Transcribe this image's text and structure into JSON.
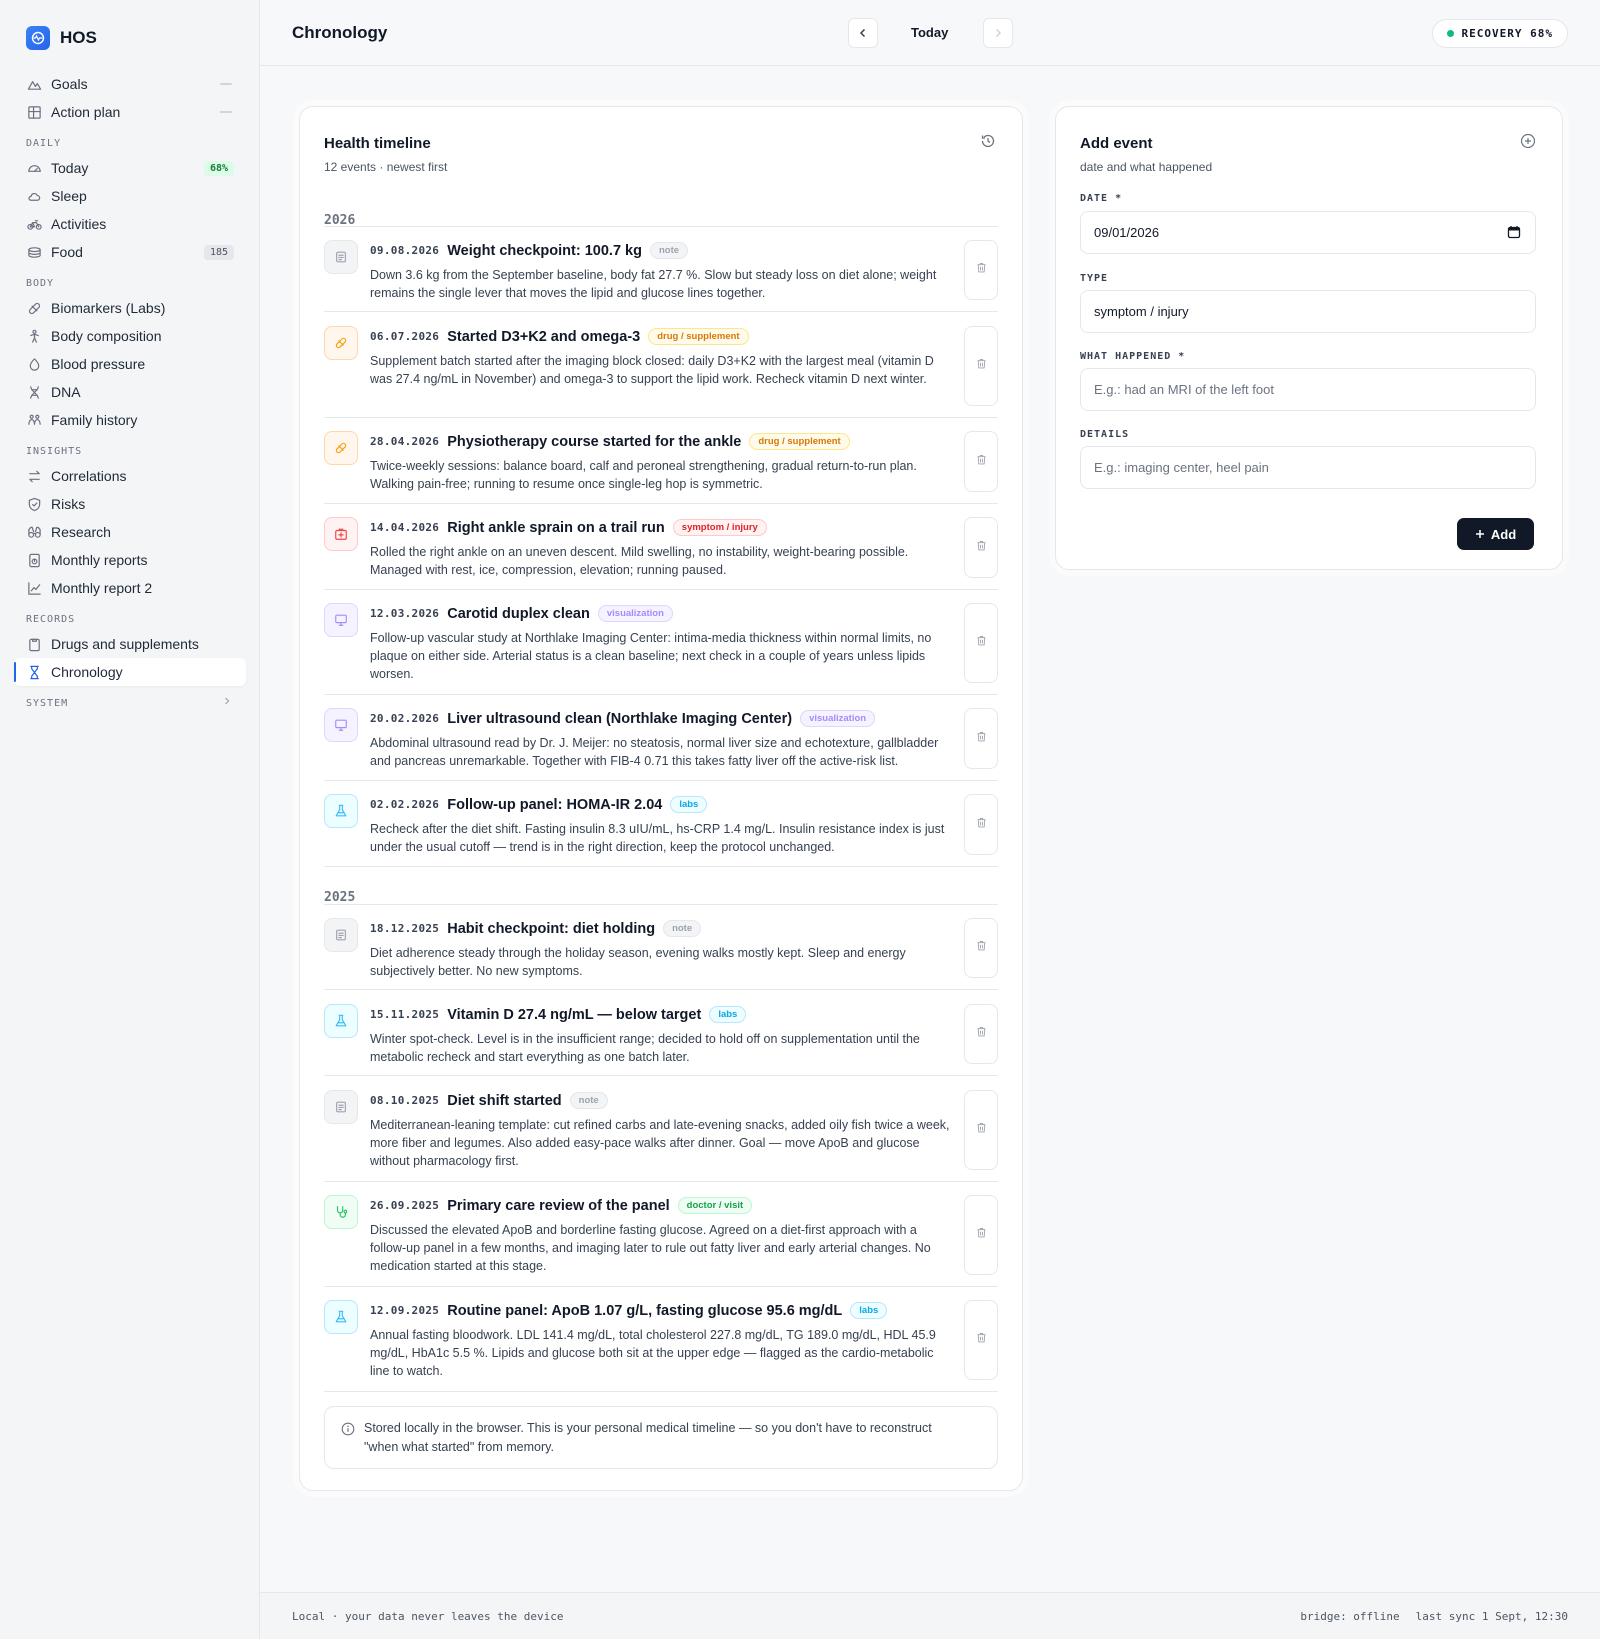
{
  "app": {
    "name": "HOS"
  },
  "sidebar": {
    "top_items": [
      {
        "label": "Goals",
        "icon": "mountain-icon"
      },
      {
        "label": "Action plan",
        "icon": "grid-icon"
      }
    ],
    "groups": [
      {
        "label": "DAILY",
        "items": [
          {
            "label": "Today",
            "icon": "gauge-icon",
            "badge": "68%"
          },
          {
            "label": "Sleep",
            "icon": "moon-cloud-icon"
          },
          {
            "label": "Activities",
            "icon": "bike-icon"
          },
          {
            "label": "Food",
            "icon": "bowl-icon",
            "badge": "185"
          }
        ]
      },
      {
        "label": "BODY",
        "items": [
          {
            "label": "Biomarkers (Labs)",
            "icon": "pill-icon"
          },
          {
            "label": "Body composition",
            "icon": "person-icon"
          },
          {
            "label": "Blood pressure",
            "icon": "drop-icon"
          },
          {
            "label": "DNA",
            "icon": "dna-icon"
          },
          {
            "label": "Family history",
            "icon": "family-icon"
          }
        ]
      },
      {
        "label": "INSIGHTS",
        "items": [
          {
            "label": "Correlations",
            "icon": "arrows-icon"
          },
          {
            "label": "Risks",
            "icon": "shield-icon"
          },
          {
            "label": "Research",
            "icon": "binoculars-icon"
          },
          {
            "label": "Monthly reports",
            "icon": "report-icon"
          },
          {
            "label": "Monthly report 2",
            "icon": "chart-line-icon"
          }
        ]
      },
      {
        "label": "RECORDS",
        "items": [
          {
            "label": "Drugs and supplements",
            "icon": "clipboard-icon"
          },
          {
            "label": "Chronology",
            "icon": "hourglass-icon",
            "active": true
          }
        ]
      }
    ],
    "system_label": "SYSTEM"
  },
  "header": {
    "title": "Chronology",
    "today_label": "Today",
    "recovery": "RECOVERY 68%",
    "recovery_color": "#10b981"
  },
  "timeline": {
    "title": "Health timeline",
    "subtitle": "12 events · newest first",
    "years": [
      {
        "year": "2026",
        "events": [
          {
            "date": "09.08.2026",
            "title": "Weight checkpoint: 100.7 kg",
            "tag": "note",
            "kind": "note",
            "desc": "Down 3.6 kg from the September baseline, body fat 27.7 %. Slow but steady loss on diet alone; weight remains the single lever that moves the lipid and glucose lines together."
          },
          {
            "date": "06.07.2026",
            "title": "Started D3+K2 and omega-3",
            "tag": "drug / supplement",
            "kind": "drug",
            "desc": "Supplement batch started after the imaging block closed: daily D3+K2 with the largest meal (vitamin D was 27.4 ng/mL in November) and omega-3 to support the lipid work. Recheck vitamin D next winter."
          },
          {
            "date": "28.04.2026",
            "title": "Physiotherapy course started for the ankle",
            "tag": "drug / supplement",
            "kind": "drug",
            "desc": "Twice-weekly sessions: balance board, calf and peroneal strengthening, gradual return-to-run plan. Walking pain-free; running to resume once single-leg hop is symmetric."
          },
          {
            "date": "14.04.2026",
            "title": "Right ankle sprain on a trail run",
            "tag": "symptom / injury",
            "kind": "symptom",
            "desc": "Rolled the right ankle on an uneven descent. Mild swelling, no instability, weight-bearing possible. Managed with rest, ice, compression, elevation; running paused."
          },
          {
            "date": "12.03.2026",
            "title": "Carotid duplex clean",
            "tag": "visualization",
            "kind": "vis",
            "desc": "Follow-up vascular study at Northlake Imaging Center: intima-media thickness within normal limits, no plaque on either side. Arterial status is a clean baseline; next check in a couple of years unless lipids worsen."
          },
          {
            "date": "20.02.2026",
            "title": "Liver ultrasound clean (Northlake Imaging Center)",
            "tag": "visualization",
            "kind": "vis",
            "desc": "Abdominal ultrasound read by Dr. J. Meijer: no steatosis, normal liver size and echotexture, gallbladder and pancreas unremarkable. Together with FIB-4 0.71 this takes fatty liver off the active-risk list."
          },
          {
            "date": "02.02.2026",
            "title": "Follow-up panel: HOMA-IR 2.04",
            "tag": "labs",
            "kind": "labs",
            "desc": "Recheck after the diet shift. Fasting insulin 8.3 uIU/mL, hs-CRP 1.4 mg/L. Insulin resistance index is just under the usual cutoff — trend is in the right direction, keep the protocol unchanged."
          }
        ]
      },
      {
        "year": "2025",
        "events": [
          {
            "date": "18.12.2025",
            "title": "Habit checkpoint: diet holding",
            "tag": "note",
            "kind": "note",
            "desc": "Diet adherence steady through the holiday season, evening walks mostly kept. Sleep and energy subjectively better. No new symptoms."
          },
          {
            "date": "15.11.2025",
            "title": "Vitamin D 27.4 ng/mL — below target",
            "tag": "labs",
            "kind": "labs",
            "desc": "Winter spot-check. Level is in the insufficient range; decided to hold off on supplementation until the metabolic recheck and start everything as one batch later."
          },
          {
            "date": "08.10.2025",
            "title": "Diet shift started",
            "tag": "note",
            "kind": "note",
            "desc": "Mediterranean-leaning template: cut refined carbs and late-evening snacks, added oily fish twice a week, more fiber and legumes. Also added easy-pace walks after dinner. Goal — move ApoB and glucose without pharmacology first."
          },
          {
            "date": "26.09.2025",
            "title": "Primary care review of the panel",
            "tag": "doctor / visit",
            "kind": "doctor",
            "desc": "Discussed the elevated ApoB and borderline fasting glucose. Agreed on a diet-first approach with a follow-up panel in a few months, and imaging later to rule out fatty liver and early arterial changes. No medication started at this stage."
          },
          {
            "date": "12.09.2025",
            "title": "Routine panel: ApoB 1.07 g/L, fasting glucose 95.6 mg/dL",
            "tag": "labs",
            "kind": "labs",
            "desc": "Annual fasting bloodwork. LDL 141.4 mg/dL, total cholesterol 227.8 mg/dL, TG 189.0 mg/dL, HDL 45.9 mg/dL, HbA1c 5.5 %. Lipids and glucose both sit at the upper edge — flagged as the cardio-metabolic line to watch."
          }
        ]
      }
    ],
    "info": "Stored locally in the browser. This is your personal medical timeline — so you don't have to reconstruct \"when what started\" from memory."
  },
  "add_event": {
    "title": "Add event",
    "subtitle": "date and what happened",
    "date_label": "DATE *",
    "date_value": "09/01/2026",
    "type_label": "TYPE",
    "type_value": "symptom / injury",
    "what_label": "WHAT HAPPENED *",
    "what_placeholder": "E.g.: had an MRI of the left foot",
    "details_label": "DETAILS",
    "details_placeholder": "E.g.: imaging center, heel pain",
    "add_label": "Add"
  },
  "footer": {
    "left": "Local · your data never leaves the device",
    "bridge": "bridge: offline",
    "sync": "last sync 1 Sept, 12:30"
  }
}
